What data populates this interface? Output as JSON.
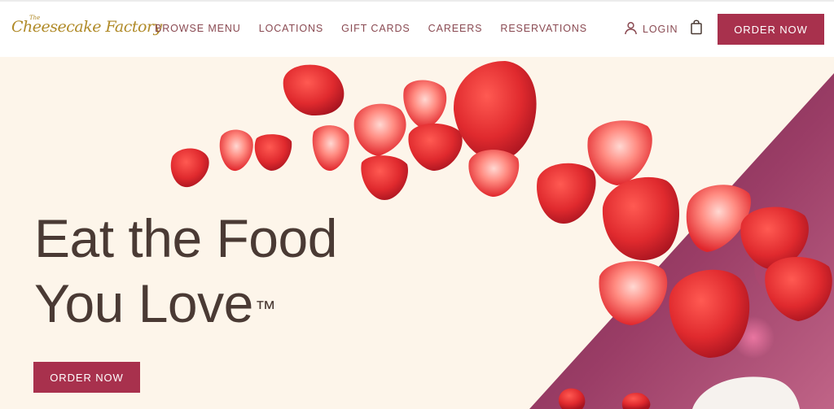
{
  "header": {
    "logo_the": "The",
    "logo_word": "Cheesecake Factory",
    "nav": [
      "BROWSE MENU",
      "LOCATIONS",
      "GIFT CARDS",
      "CAREERS",
      "RESERVATIONS"
    ],
    "login_label": "LOGIN",
    "order_label": "ORDER NOW"
  },
  "hero": {
    "headline_line1": "Eat the Food",
    "headline_line2": "You Love",
    "trademark": "™",
    "cta_label": "ORDER NOW"
  },
  "colors": {
    "brand": "#a8314d",
    "nav_text": "#8a4a52",
    "headline": "#4a3a34",
    "hero_bg": "#fdf5ea",
    "diagonal_panel": "#8a2a50",
    "logo_gold": "#b08a28"
  },
  "icons": {
    "login": "user-icon",
    "cart": "shopping-bag-icon"
  }
}
